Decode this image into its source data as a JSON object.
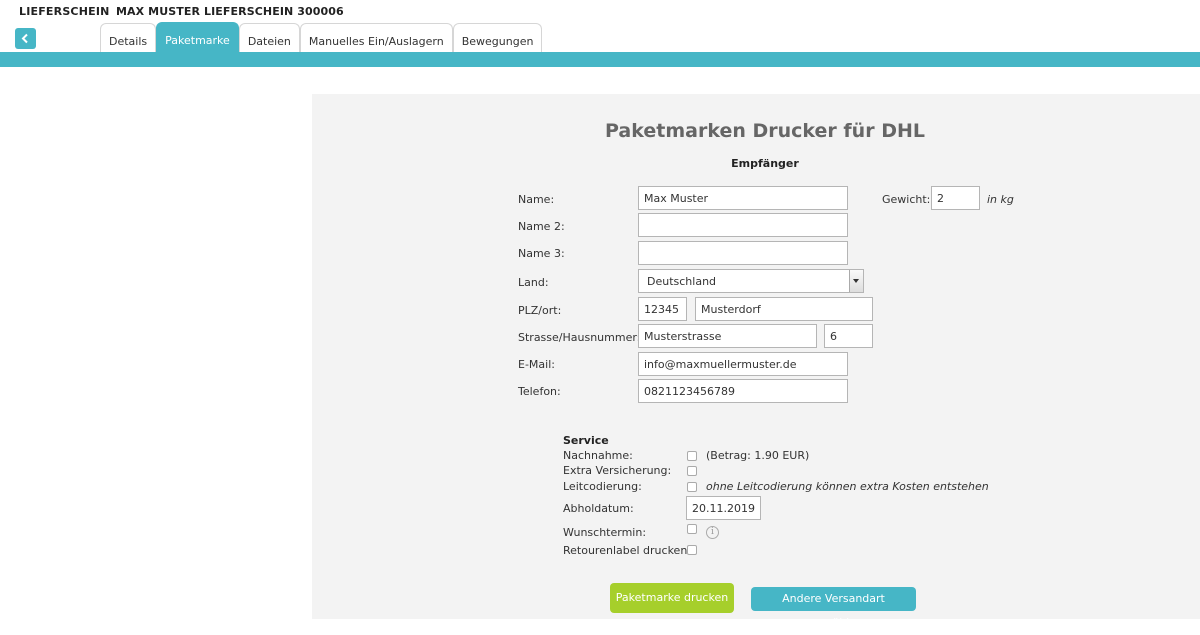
{
  "header": {
    "doc_type": "LIEFERSCHEIN",
    "doc_title": "MAX MUSTER LIEFERSCHEIN 300006",
    "back_icon": "chevron-left-icon"
  },
  "tabs": [
    {
      "label": "Details",
      "active": false
    },
    {
      "label": "Paketmarke",
      "active": true
    },
    {
      "label": "Dateien",
      "active": false
    },
    {
      "label": "Manuelles Ein/Auslagern",
      "active": false
    },
    {
      "label": "Bewegungen",
      "active": false
    }
  ],
  "colors": {
    "accent": "#46b6c6",
    "print_button": "#a6cf2b",
    "panel": "#f3f3f3"
  },
  "form": {
    "title": "Paketmarken Drucker für DHL",
    "subtitle": "Empfänger",
    "name": {
      "label": "Name:",
      "value": "Max Muster"
    },
    "name2": {
      "label": "Name 2:",
      "value": ""
    },
    "name3": {
      "label": "Name 3:",
      "value": ""
    },
    "country": {
      "label": "Land:",
      "value": "Deutschland"
    },
    "zip_city": {
      "label": "PLZ/ort:",
      "zip": "12345",
      "city": "Musterdorf"
    },
    "street": {
      "label": "Strasse/Hausnummer:",
      "street": "Musterstrasse",
      "number": "6"
    },
    "email": {
      "label": "E-Mail:",
      "value": "info@maxmuellermuster.de"
    },
    "phone": {
      "label": "Telefon:",
      "value": "0821123456789"
    },
    "weight": {
      "label": "Gewicht:",
      "value": "2",
      "unit": "in kg"
    }
  },
  "service": {
    "heading": "Service",
    "cod": {
      "label": "Nachnahme:",
      "note": "(Betrag: 1.90 EUR)",
      "checked": false
    },
    "insurance": {
      "label": "Extra Versicherung:",
      "checked": false
    },
    "routing": {
      "label": "Leitcodierung:",
      "note": "ohne Leitcodierung können extra Kosten entstehen",
      "checked": false
    },
    "pickup": {
      "label": "Abholdatum:",
      "value": "20.11.2019"
    },
    "preferred": {
      "label": "Wunschtermin:",
      "checked": false,
      "info_icon": "info-icon"
    },
    "return_label": {
      "label": "Retourenlabel drucken:",
      "checked": false
    }
  },
  "actions": {
    "print_label": "Paketmarke drucken",
    "other_shipping": "Andere Versandart auswählen"
  }
}
